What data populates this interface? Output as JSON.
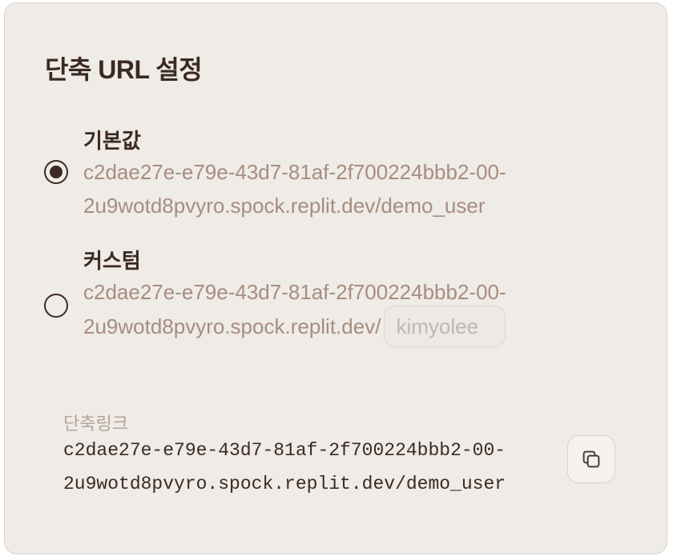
{
  "settings": {
    "title": "단축 URL 설정",
    "options": [
      {
        "label": "기본값",
        "url_line1": "c2dae27e-e79e-43d7-81af-2f700224bbb2-00-",
        "url_line2": "2u9wotd8pvyro.spock.replit.dev/demo_user",
        "selected": true
      },
      {
        "label": "커스텀",
        "url_line1": "c2dae27e-e79e-43d7-81af-2f700224bbb2-00-",
        "url_line2": "2u9wotd8pvyro.spock.replit.dev/",
        "input_placeholder": "kimyolee",
        "input_value": "",
        "selected": false
      }
    ],
    "short_link": {
      "label": "단축링크",
      "line1": "c2dae27e-e79e-43d7-81af-2f700224bbb2-00-",
      "line2": "2u9wotd8pvyro.spock.replit.dev/demo_user",
      "copy_icon": "copy-icon"
    }
  },
  "colors": {
    "card_background": "#efebe7",
    "text_dark": "#3b2a22",
    "url_muted": "#a78d80",
    "label_muted": "#b5a49b"
  }
}
